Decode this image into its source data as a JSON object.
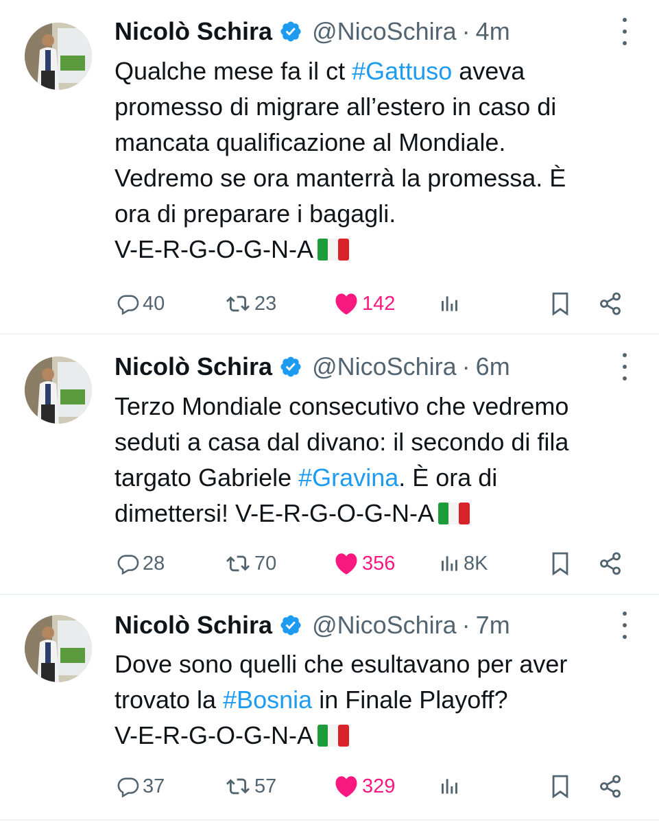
{
  "tweets": [
    {
      "author_name": "Nicolò Schira",
      "handle": "@NicoSchira",
      "separator": "·",
      "time": "4m",
      "lines": [
        [
          {
            "t": "Qualche mese fa il ct "
          },
          {
            "t": "#Gattuso",
            "tag": true
          },
          {
            "t": " aveva"
          }
        ],
        [
          {
            "t": "promesso di migrare all’estero in caso di"
          }
        ],
        [
          {
            "t": "mancata qualificazione al Mondiale."
          }
        ],
        [
          {
            "t": "Vedremo se ora manterrà la promessa. È"
          }
        ],
        [
          {
            "t": "ora di preparare i bagagli."
          }
        ],
        [
          {
            "t": "V-E-R-G-O-G-N-A"
          },
          {
            "flag": "italy-flag"
          }
        ]
      ],
      "replies": "40",
      "retweets": "23",
      "likes": "142",
      "views": ""
    },
    {
      "author_name": "Nicolò Schira",
      "handle": "@NicoSchira",
      "separator": "·",
      "time": "6m",
      "lines": [
        [
          {
            "t": "Terzo Mondiale consecutivo che vedremo"
          }
        ],
        [
          {
            "t": "seduti a casa dal divano: il secondo di fila"
          }
        ],
        [
          {
            "t": "targato Gabriele "
          },
          {
            "t": "#Gravina",
            "tag": true
          },
          {
            "t": ". È ora di"
          }
        ],
        [
          {
            "t": "dimettersi! V-E-R-G-O-G-N-A"
          },
          {
            "flag": "italy-flag"
          }
        ]
      ],
      "replies": "28",
      "retweets": "70",
      "likes": "356",
      "views": "8K"
    },
    {
      "author_name": "Nicolò Schira",
      "handle": "@NicoSchira",
      "separator": "·",
      "time": "7m",
      "lines": [
        [
          {
            "t": "Dove sono quelli che esultavano per aver"
          }
        ],
        [
          {
            "t": "trovato la "
          },
          {
            "t": "#Bosnia",
            "tag": true
          },
          {
            "t": " in Finale Playoff?"
          }
        ],
        [
          {
            "t": "V-E-R-G-O-G-N-A"
          },
          {
            "flag": "italy-flag"
          }
        ]
      ],
      "replies": "37",
      "retweets": "57",
      "likes": "329",
      "views": ""
    }
  ],
  "icons": {
    "verified": "verified-badge-icon",
    "reply": "reply-icon",
    "retweet": "retweet-icon",
    "like": "heart-icon",
    "views": "views-icon",
    "bookmark": "bookmark-icon",
    "share": "share-icon",
    "more": "more-options-icon"
  },
  "colors": {
    "text": "#0f1419",
    "secondary": "#536471",
    "hashtag": "#1d9bf0",
    "like": "#f91880",
    "verified": "#1d9bf0",
    "divider": "#eff3f4"
  }
}
